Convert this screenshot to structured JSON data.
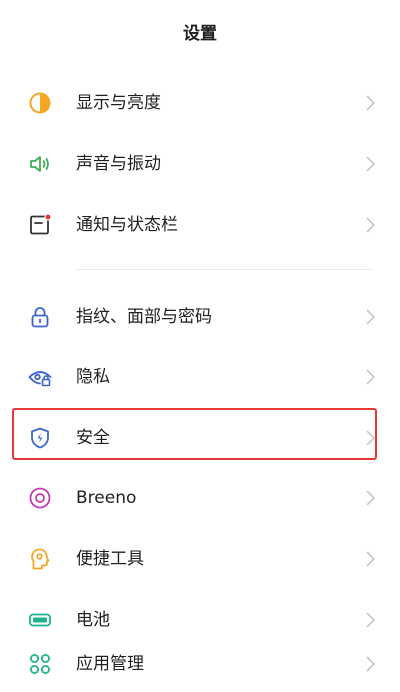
{
  "header": {
    "title": "设置"
  },
  "items": [
    {
      "label": "显示与亮度",
      "icon": "display-brightness-icon"
    },
    {
      "label": "声音与振动",
      "icon": "speaker-icon"
    },
    {
      "label": "通知与状态栏",
      "icon": "notification-icon"
    },
    {
      "label": "指纹、面部与密码",
      "icon": "lock-icon"
    },
    {
      "label": "隐私",
      "icon": "privacy-eye-icon"
    },
    {
      "label": "安全",
      "icon": "shield-icon"
    },
    {
      "label": "Breeno",
      "icon": "breeno-icon"
    },
    {
      "label": "便捷工具",
      "icon": "convenience-tools-icon"
    },
    {
      "label": "电池",
      "icon": "battery-icon"
    },
    {
      "label": "应用管理",
      "icon": "app-management-icon"
    }
  ],
  "colors": {
    "orange": "#f5a623",
    "green": "#3cae5a",
    "red": "#e53935",
    "blue": "#3b67c9",
    "purple": "#c23cae",
    "teal": "#1fb28a",
    "chevron": "#c8c8c8"
  }
}
